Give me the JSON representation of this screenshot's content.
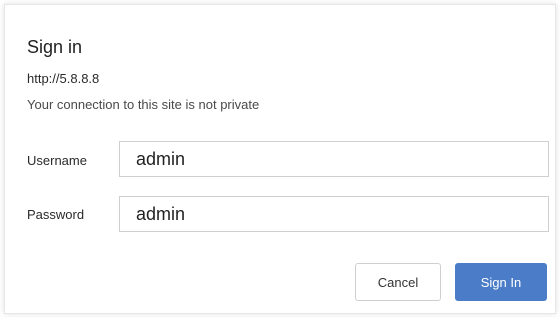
{
  "dialog": {
    "title": "Sign in",
    "url": "http://5.8.8.8",
    "warning": "Your connection to this site is not private"
  },
  "form": {
    "username_label": "Username",
    "username_value": "admin",
    "password_label": "Password",
    "password_value": "admin"
  },
  "buttons": {
    "cancel_label": "Cancel",
    "signin_label": "Sign In"
  },
  "colors": {
    "primary": "#4a7cc8",
    "border": "#cfcfcf"
  }
}
